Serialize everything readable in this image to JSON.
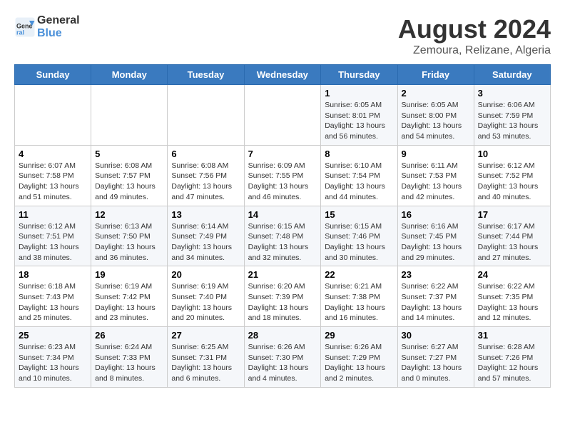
{
  "header": {
    "logo_line1": "General",
    "logo_line2": "Blue",
    "main_title": "August 2024",
    "subtitle": "Zemoura, Relizane, Algeria"
  },
  "days_of_week": [
    "Sunday",
    "Monday",
    "Tuesday",
    "Wednesday",
    "Thursday",
    "Friday",
    "Saturday"
  ],
  "weeks": [
    [
      {
        "day": "",
        "info": ""
      },
      {
        "day": "",
        "info": ""
      },
      {
        "day": "",
        "info": ""
      },
      {
        "day": "",
        "info": ""
      },
      {
        "day": "1",
        "info": "Sunrise: 6:05 AM\nSunset: 8:01 PM\nDaylight: 13 hours\nand 56 minutes."
      },
      {
        "day": "2",
        "info": "Sunrise: 6:05 AM\nSunset: 8:00 PM\nDaylight: 13 hours\nand 54 minutes."
      },
      {
        "day": "3",
        "info": "Sunrise: 6:06 AM\nSunset: 7:59 PM\nDaylight: 13 hours\nand 53 minutes."
      }
    ],
    [
      {
        "day": "4",
        "info": "Sunrise: 6:07 AM\nSunset: 7:58 PM\nDaylight: 13 hours\nand 51 minutes."
      },
      {
        "day": "5",
        "info": "Sunrise: 6:08 AM\nSunset: 7:57 PM\nDaylight: 13 hours\nand 49 minutes."
      },
      {
        "day": "6",
        "info": "Sunrise: 6:08 AM\nSunset: 7:56 PM\nDaylight: 13 hours\nand 47 minutes."
      },
      {
        "day": "7",
        "info": "Sunrise: 6:09 AM\nSunset: 7:55 PM\nDaylight: 13 hours\nand 46 minutes."
      },
      {
        "day": "8",
        "info": "Sunrise: 6:10 AM\nSunset: 7:54 PM\nDaylight: 13 hours\nand 44 minutes."
      },
      {
        "day": "9",
        "info": "Sunrise: 6:11 AM\nSunset: 7:53 PM\nDaylight: 13 hours\nand 42 minutes."
      },
      {
        "day": "10",
        "info": "Sunrise: 6:12 AM\nSunset: 7:52 PM\nDaylight: 13 hours\nand 40 minutes."
      }
    ],
    [
      {
        "day": "11",
        "info": "Sunrise: 6:12 AM\nSunset: 7:51 PM\nDaylight: 13 hours\nand 38 minutes."
      },
      {
        "day": "12",
        "info": "Sunrise: 6:13 AM\nSunset: 7:50 PM\nDaylight: 13 hours\nand 36 minutes."
      },
      {
        "day": "13",
        "info": "Sunrise: 6:14 AM\nSunset: 7:49 PM\nDaylight: 13 hours\nand 34 minutes."
      },
      {
        "day": "14",
        "info": "Sunrise: 6:15 AM\nSunset: 7:48 PM\nDaylight: 13 hours\nand 32 minutes."
      },
      {
        "day": "15",
        "info": "Sunrise: 6:15 AM\nSunset: 7:46 PM\nDaylight: 13 hours\nand 30 minutes."
      },
      {
        "day": "16",
        "info": "Sunrise: 6:16 AM\nSunset: 7:45 PM\nDaylight: 13 hours\nand 29 minutes."
      },
      {
        "day": "17",
        "info": "Sunrise: 6:17 AM\nSunset: 7:44 PM\nDaylight: 13 hours\nand 27 minutes."
      }
    ],
    [
      {
        "day": "18",
        "info": "Sunrise: 6:18 AM\nSunset: 7:43 PM\nDaylight: 13 hours\nand 25 minutes."
      },
      {
        "day": "19",
        "info": "Sunrise: 6:19 AM\nSunset: 7:42 PM\nDaylight: 13 hours\nand 23 minutes."
      },
      {
        "day": "20",
        "info": "Sunrise: 6:19 AM\nSunset: 7:40 PM\nDaylight: 13 hours\nand 20 minutes."
      },
      {
        "day": "21",
        "info": "Sunrise: 6:20 AM\nSunset: 7:39 PM\nDaylight: 13 hours\nand 18 minutes."
      },
      {
        "day": "22",
        "info": "Sunrise: 6:21 AM\nSunset: 7:38 PM\nDaylight: 13 hours\nand 16 minutes."
      },
      {
        "day": "23",
        "info": "Sunrise: 6:22 AM\nSunset: 7:37 PM\nDaylight: 13 hours\nand 14 minutes."
      },
      {
        "day": "24",
        "info": "Sunrise: 6:22 AM\nSunset: 7:35 PM\nDaylight: 13 hours\nand 12 minutes."
      }
    ],
    [
      {
        "day": "25",
        "info": "Sunrise: 6:23 AM\nSunset: 7:34 PM\nDaylight: 13 hours\nand 10 minutes."
      },
      {
        "day": "26",
        "info": "Sunrise: 6:24 AM\nSunset: 7:33 PM\nDaylight: 13 hours\nand 8 minutes."
      },
      {
        "day": "27",
        "info": "Sunrise: 6:25 AM\nSunset: 7:31 PM\nDaylight: 13 hours\nand 6 minutes."
      },
      {
        "day": "28",
        "info": "Sunrise: 6:26 AM\nSunset: 7:30 PM\nDaylight: 13 hours\nand 4 minutes."
      },
      {
        "day": "29",
        "info": "Sunrise: 6:26 AM\nSunset: 7:29 PM\nDaylight: 13 hours\nand 2 minutes."
      },
      {
        "day": "30",
        "info": "Sunrise: 6:27 AM\nSunset: 7:27 PM\nDaylight: 13 hours\nand 0 minutes."
      },
      {
        "day": "31",
        "info": "Sunrise: 6:28 AM\nSunset: 7:26 PM\nDaylight: 12 hours\nand 57 minutes."
      }
    ]
  ]
}
